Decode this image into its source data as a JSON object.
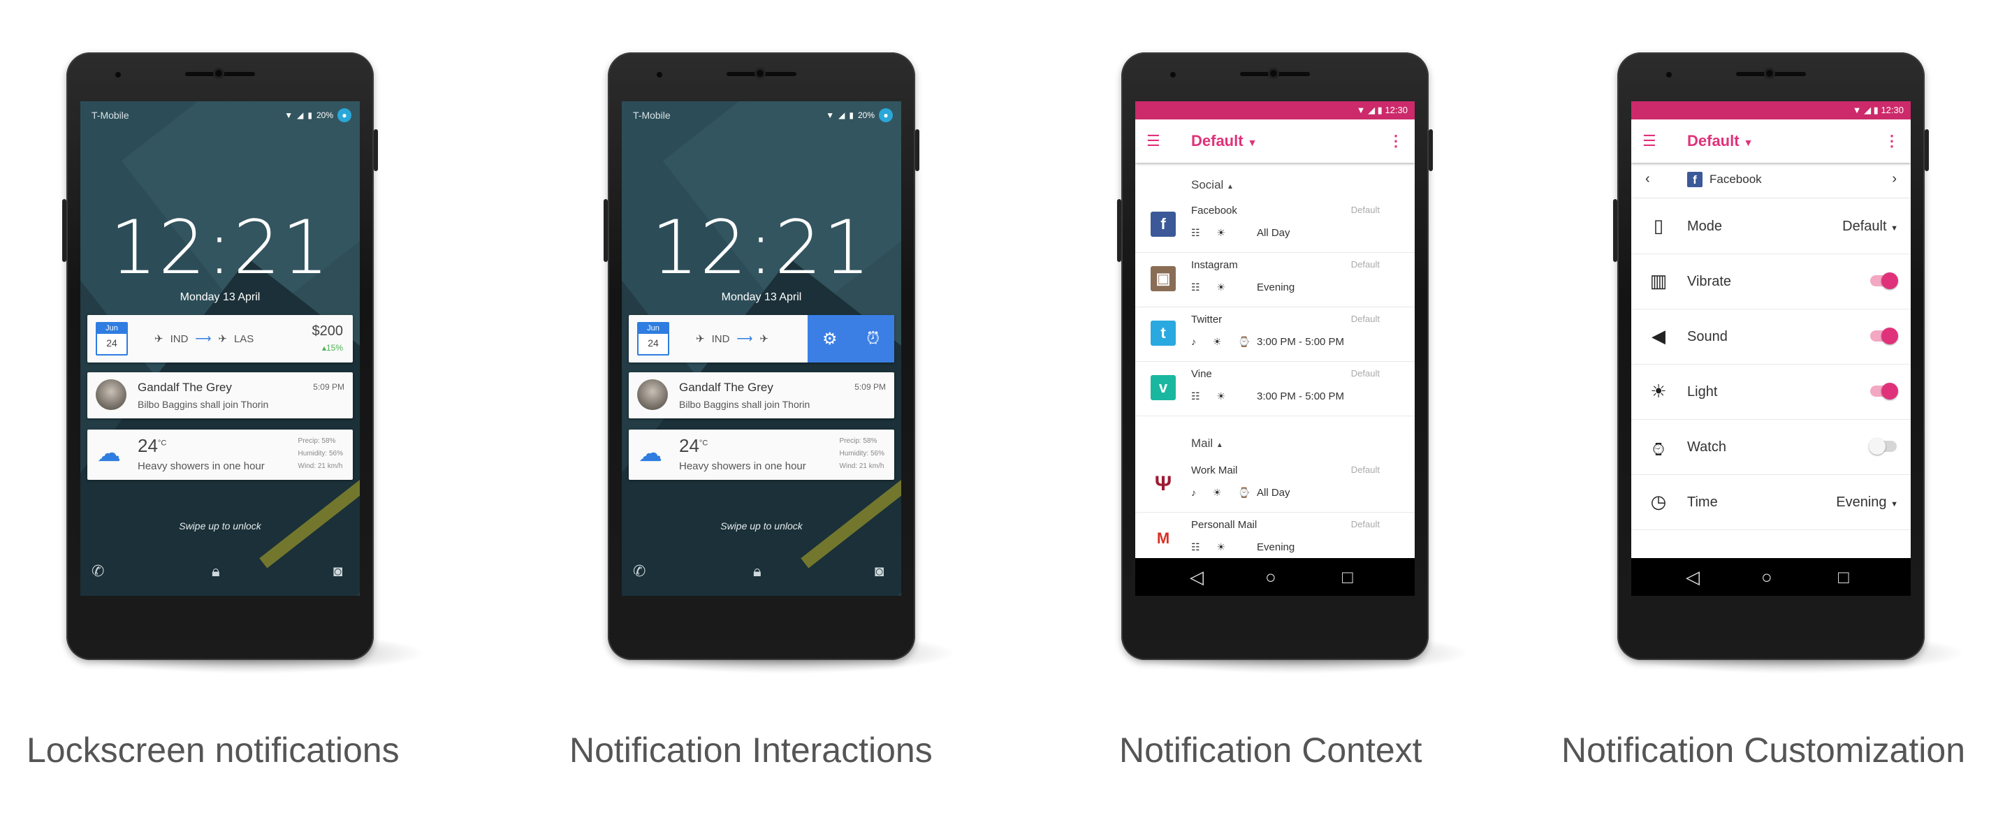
{
  "captions": [
    "Lockscreen notifications",
    "Notification Interactions",
    "Notification Context",
    "Notification Customization"
  ],
  "lockscreen": {
    "carrier": "T-Mobile",
    "battery": "20%",
    "time": "12:21",
    "date": "Monday 13 April",
    "flight": {
      "month": "Jun",
      "day": "24",
      "from": "IND",
      "to": "LAS",
      "price": "$200",
      "change": "▴15%"
    },
    "message": {
      "name": "Gandalf The Grey",
      "body": "Bilbo Baggins shall join Thorin",
      "time": "5:09 PM"
    },
    "weather": {
      "temp": "24",
      "unit": "°C",
      "desc": "Heavy showers in one hour",
      "precip": "Precip: 58%",
      "humidity": "Humidity: 56%",
      "wind": "Wind: 21 km/h"
    },
    "swipe": "Swipe up to unlock"
  },
  "app": {
    "status_time": "12:30",
    "title": "Default",
    "context": {
      "section_social": "Social",
      "section_mail": "Mail",
      "default_label": "Default",
      "apps": [
        {
          "name": "Facebook",
          "logo": "f",
          "color": "#3b5998",
          "icons": "☷ ☀",
          "when": "All Day"
        },
        {
          "name": "Instagram",
          "logo": "▣",
          "color": "#8a6d55",
          "icons": "☷ ☀",
          "when": "Evening"
        },
        {
          "name": "Twitter",
          "logo": "t",
          "color": "#2aa9e0",
          "icons": "♪ ☀ ⌚",
          "when": "3:00 PM  -  5:00 PM"
        },
        {
          "name": "Vine",
          "logo": "v",
          "color": "#1ab7a0",
          "icons": "☷ ☀",
          "when": "3:00 PM  -  5:00 PM"
        },
        {
          "name": "Work Mail",
          "logo": "Ψ",
          "color": "#9e1b32",
          "icons": "♪ ☀ ⌚",
          "when": "All Day"
        },
        {
          "name": "Personall Mail",
          "logo": "M",
          "color": "#d93025",
          "icons": "☷ ☀",
          "when": "Evening"
        }
      ]
    },
    "customization": {
      "app_name": "Facebook",
      "options": [
        {
          "label": "Mode",
          "value": "Default",
          "icon": "phone-icon"
        },
        {
          "label": "Vibrate",
          "toggle": true,
          "icon": "vibrate-icon"
        },
        {
          "label": "Sound",
          "toggle": true,
          "icon": "speaker-icon"
        },
        {
          "label": "Light",
          "toggle": true,
          "icon": "sun-icon"
        },
        {
          "label": "Watch",
          "toggle": false,
          "icon": "watch-icon"
        },
        {
          "label": "Time",
          "value": "Evening",
          "icon": "clock-icon"
        }
      ]
    }
  },
  "colors": {
    "accent": "#e0327a",
    "statusbar": "#cc2a6a",
    "action_blue": "#3b7fe5"
  }
}
